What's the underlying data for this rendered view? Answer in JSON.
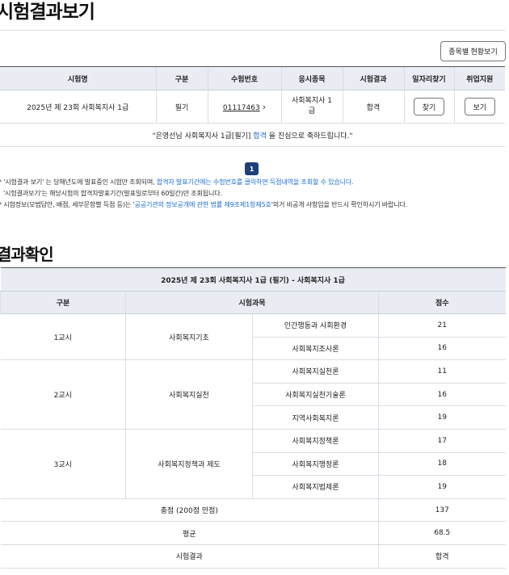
{
  "page": {
    "title": "시험결과보기",
    "status_button": "종목별 현황보기",
    "section_title": "결과확인"
  },
  "results_table": {
    "headers": [
      "시험명",
      "구분",
      "수험번호",
      "응시종목",
      "시험결과",
      "일자리찾기",
      "취업지원"
    ],
    "row": {
      "exam_name": "2025년 제 23회 사회복지사 1급",
      "category": "필기",
      "exam_number": "01117463",
      "subject": "사회복지사 1급",
      "result": "합격",
      "job_search_button": "찾기",
      "employment_button": "보기"
    },
    "congrats": {
      "prefix": "\"은영선님 사회복지사 1급[필기] ",
      "highlight": "합격",
      "suffix": " 을 진심으로 축하드립니다.\""
    }
  },
  "pagination": {
    "current": "1"
  },
  "notes": {
    "n1_a": "* '시험결과 보기' 는 당해년도에 발표중인 시험만 조회되며, ",
    "n1_b": "합격자 발표기간에는 수험번호를 클릭하면 득점내역을 조회할 수 있습니다.",
    "n2": "'시험결과보기'는 해당시험의 합격자발표기간(발표일로부터 60일간)만 조회됩니다.",
    "n3_a": "* 시험정보(모범답안, 배점, 세부문항별 득점 등)는 '",
    "n3_b": "공공기관의 정보공개에 관한 법률 제9조제1항제5호",
    "n3_c": "'의거 비공개 사항임을 반드시 확인하시기 바랍니다."
  },
  "score_table": {
    "caption": "2025년 제 23회 사회복지사 1급 (필기) - 사회복지사 1급",
    "headers": {
      "category": "구분",
      "subjects": "시험과목",
      "score": "점수"
    },
    "periods": [
      {
        "name": "1교시",
        "group": "사회복지기초",
        "items": [
          {
            "subject": "인간행동과 사회환경",
            "score": "21"
          },
          {
            "subject": "사회복지조사론",
            "score": "16"
          }
        ]
      },
      {
        "name": "2교시",
        "group": "사회복지실천",
        "items": [
          {
            "subject": "사회복지실천론",
            "score": "11"
          },
          {
            "subject": "사회복지실천기술론",
            "score": "16"
          },
          {
            "subject": "지역사회복지론",
            "score": "19"
          }
        ]
      },
      {
        "name": "3교시",
        "group": "사회복지정책과 제도",
        "items": [
          {
            "subject": "사회복지정책론",
            "score": "17"
          },
          {
            "subject": "사회복지행정론",
            "score": "18"
          },
          {
            "subject": "사회복지법제론",
            "score": "19"
          }
        ]
      }
    ],
    "summary": [
      {
        "label": "총점 (200점 만점)",
        "value": "137"
      },
      {
        "label": "평균",
        "value": "68.5"
      },
      {
        "label": "시험결과",
        "value": "합격"
      }
    ]
  }
}
